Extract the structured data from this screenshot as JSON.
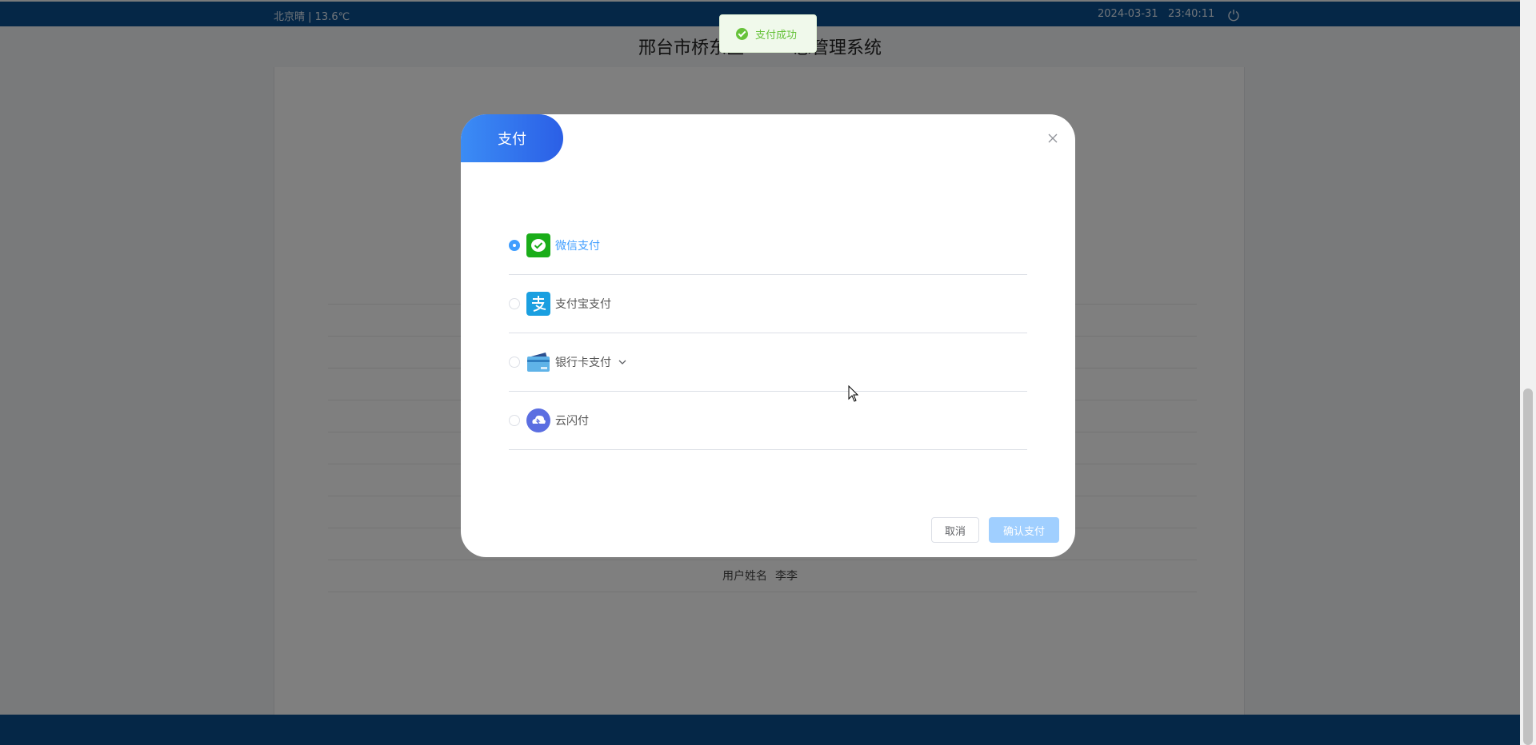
{
  "header": {
    "weather": "北京晴 | 13.6℃",
    "datetime": "2024-03-31   23:40:11",
    "title": "邢台市桥东区",
    "title_tail": "息管理系统"
  },
  "content": {
    "user_name_label": "用户姓名",
    "user_name_value": "李李"
  },
  "toast": {
    "message": "支付成功"
  },
  "dialog": {
    "title": "支付",
    "options": [
      {
        "label": "微信支付",
        "icon": "wechat-pay-icon",
        "selected": true
      },
      {
        "label": "支付宝支付",
        "icon": "alipay-icon",
        "selected": false
      },
      {
        "label": "银行卡支付",
        "icon": "bank-card-icon",
        "selected": false
      },
      {
        "label": "云闪付",
        "icon": "cloud-quickpass-icon",
        "selected": false
      }
    ],
    "cancel_label": "取消",
    "confirm_label": "确认支付"
  },
  "colors": {
    "navy": "#0b4f8f",
    "accent": "#409eff",
    "success": "#67c23a",
    "wechat": "#1aad19",
    "alipay": "#1a9fe0",
    "unionpay": "#5b6ee1"
  }
}
